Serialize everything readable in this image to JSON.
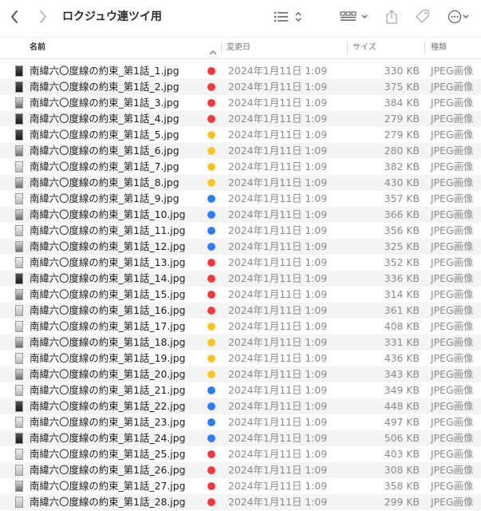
{
  "toolbar": {
    "title": "ロクジュウ連ツイ用",
    "icons": [
      "back-icon",
      "forward-icon",
      "list-view-icon",
      "gallery-view-icon",
      "share-icon",
      "tag-icon",
      "more-icon"
    ]
  },
  "columns": {
    "name": "名前",
    "date": "変更日",
    "size": "サイズ",
    "kind": "種類"
  },
  "colors": {
    "red": "#ee3b3b",
    "yellow": "#f7c52a",
    "blue": "#2f7cf6"
  },
  "files": [
    {
      "name": "南緯六〇度線の約束_第1話_1.jpg",
      "tag": "red",
      "date": "2024年1月11日 1:09",
      "size": "330 KB",
      "kind": "JPEG画像",
      "thumb": "dark"
    },
    {
      "name": "南緯六〇度線の約束_第1話_2.jpg",
      "tag": "red",
      "date": "2024年1月11日 1:09",
      "size": "375 KB",
      "kind": "JPEG画像",
      "thumb": "dark"
    },
    {
      "name": "南緯六〇度線の約束_第1話_3.jpg",
      "tag": "red",
      "date": "2024年1月11日 1:09",
      "size": "384 KB",
      "kind": "JPEG画像",
      "thumb": "mid"
    },
    {
      "name": "南緯六〇度線の約束_第1話_4.jpg",
      "tag": "red",
      "date": "2024年1月11日 1:09",
      "size": "279 KB",
      "kind": "JPEG画像",
      "thumb": "dark"
    },
    {
      "name": "南緯六〇度線の約束_第1話_5.jpg",
      "tag": "yellow",
      "date": "2024年1月11日 1:09",
      "size": "279 KB",
      "kind": "JPEG画像",
      "thumb": "dark"
    },
    {
      "name": "南緯六〇度線の約束_第1話_6.jpg",
      "tag": "yellow",
      "date": "2024年1月11日 1:09",
      "size": "280 KB",
      "kind": "JPEG画像",
      "thumb": "mid"
    },
    {
      "name": "南緯六〇度線の約束_第1話_7.jpg",
      "tag": "yellow",
      "date": "2024年1月11日 1:09",
      "size": "382 KB",
      "kind": "JPEG画像",
      "thumb": "light"
    },
    {
      "name": "南緯六〇度線の約束_第1話_8.jpg",
      "tag": "yellow",
      "date": "2024年1月11日 1:09",
      "size": "430 KB",
      "kind": "JPEG画像",
      "thumb": "mid"
    },
    {
      "name": "南緯六〇度線の約束_第1話_9.jpg",
      "tag": "blue",
      "date": "2024年1月11日 1:09",
      "size": "357 KB",
      "kind": "JPEG画像",
      "thumb": "light"
    },
    {
      "name": "南緯六〇度線の約束_第1話_10.jpg",
      "tag": "blue",
      "date": "2024年1月11日 1:09",
      "size": "366 KB",
      "kind": "JPEG画像",
      "thumb": "mid"
    },
    {
      "name": "南緯六〇度線の約束_第1話_11.jpg",
      "tag": "blue",
      "date": "2024年1月11日 1:09",
      "size": "356 KB",
      "kind": "JPEG画像",
      "thumb": "light"
    },
    {
      "name": "南緯六〇度線の約束_第1話_12.jpg",
      "tag": "blue",
      "date": "2024年1月11日 1:09",
      "size": "325 KB",
      "kind": "JPEG画像",
      "thumb": "mid"
    },
    {
      "name": "南緯六〇度線の約束_第1話_13.jpg",
      "tag": "red",
      "date": "2024年1月11日 1:09",
      "size": "352 KB",
      "kind": "JPEG画像",
      "thumb": "light"
    },
    {
      "name": "南緯六〇度線の約束_第1話_14.jpg",
      "tag": "red",
      "date": "2024年1月11日 1:09",
      "size": "336 KB",
      "kind": "JPEG画像",
      "thumb": "dark"
    },
    {
      "name": "南緯六〇度線の約束_第1話_15.jpg",
      "tag": "red",
      "date": "2024年1月11日 1:09",
      "size": "314 KB",
      "kind": "JPEG画像",
      "thumb": "mid"
    },
    {
      "name": "南緯六〇度線の約束_第1話_16.jpg",
      "tag": "red",
      "date": "2024年1月11日 1:09",
      "size": "361 KB",
      "kind": "JPEG画像",
      "thumb": "light"
    },
    {
      "name": "南緯六〇度線の約束_第1話_17.jpg",
      "tag": "yellow",
      "date": "2024年1月11日 1:09",
      "size": "408 KB",
      "kind": "JPEG画像",
      "thumb": "light"
    },
    {
      "name": "南緯六〇度線の約束_第1話_18.jpg",
      "tag": "yellow",
      "date": "2024年1月11日 1:09",
      "size": "331 KB",
      "kind": "JPEG画像",
      "thumb": "mid"
    },
    {
      "name": "南緯六〇度線の約束_第1話_19.jpg",
      "tag": "yellow",
      "date": "2024年1月11日 1:09",
      "size": "436 KB",
      "kind": "JPEG画像",
      "thumb": "light"
    },
    {
      "name": "南緯六〇度線の約束_第1話_20.jpg",
      "tag": "yellow",
      "date": "2024年1月11日 1:09",
      "size": "343 KB",
      "kind": "JPEG画像",
      "thumb": "mid"
    },
    {
      "name": "南緯六〇度線の約束_第1話_21.jpg",
      "tag": "blue",
      "date": "2024年1月11日 1:09",
      "size": "349 KB",
      "kind": "JPEG画像",
      "thumb": "light"
    },
    {
      "name": "南緯六〇度線の約束_第1話_22.jpg",
      "tag": "blue",
      "date": "2024年1月11日 1:09",
      "size": "448 KB",
      "kind": "JPEG画像",
      "thumb": "dark"
    },
    {
      "name": "南緯六〇度線の約束_第1話_23.jpg",
      "tag": "blue",
      "date": "2024年1月11日 1:09",
      "size": "497 KB",
      "kind": "JPEG画像",
      "thumb": "light"
    },
    {
      "name": "南緯六〇度線の約束_第1話_24.jpg",
      "tag": "blue",
      "date": "2024年1月11日 1:09",
      "size": "506 KB",
      "kind": "JPEG画像",
      "thumb": "dark"
    },
    {
      "name": "南緯六〇度線の約束_第1話_25.jpg",
      "tag": "red",
      "date": "2024年1月11日 1:09",
      "size": "403 KB",
      "kind": "JPEG画像",
      "thumb": "light"
    },
    {
      "name": "南緯六〇度線の約束_第1話_26.jpg",
      "tag": "red",
      "date": "2024年1月11日 1:09",
      "size": "308 KB",
      "kind": "JPEG画像",
      "thumb": "light"
    },
    {
      "name": "南緯六〇度線の約束_第1話_27.jpg",
      "tag": "red",
      "date": "2024年1月11日 1:09",
      "size": "358 KB",
      "kind": "JPEG画像",
      "thumb": "mid"
    },
    {
      "name": "南緯六〇度線の約束_第1話_28.jpg",
      "tag": "red",
      "date": "2024年1月11日 1:09",
      "size": "299 KB",
      "kind": "JPEG画像",
      "thumb": "light"
    }
  ]
}
